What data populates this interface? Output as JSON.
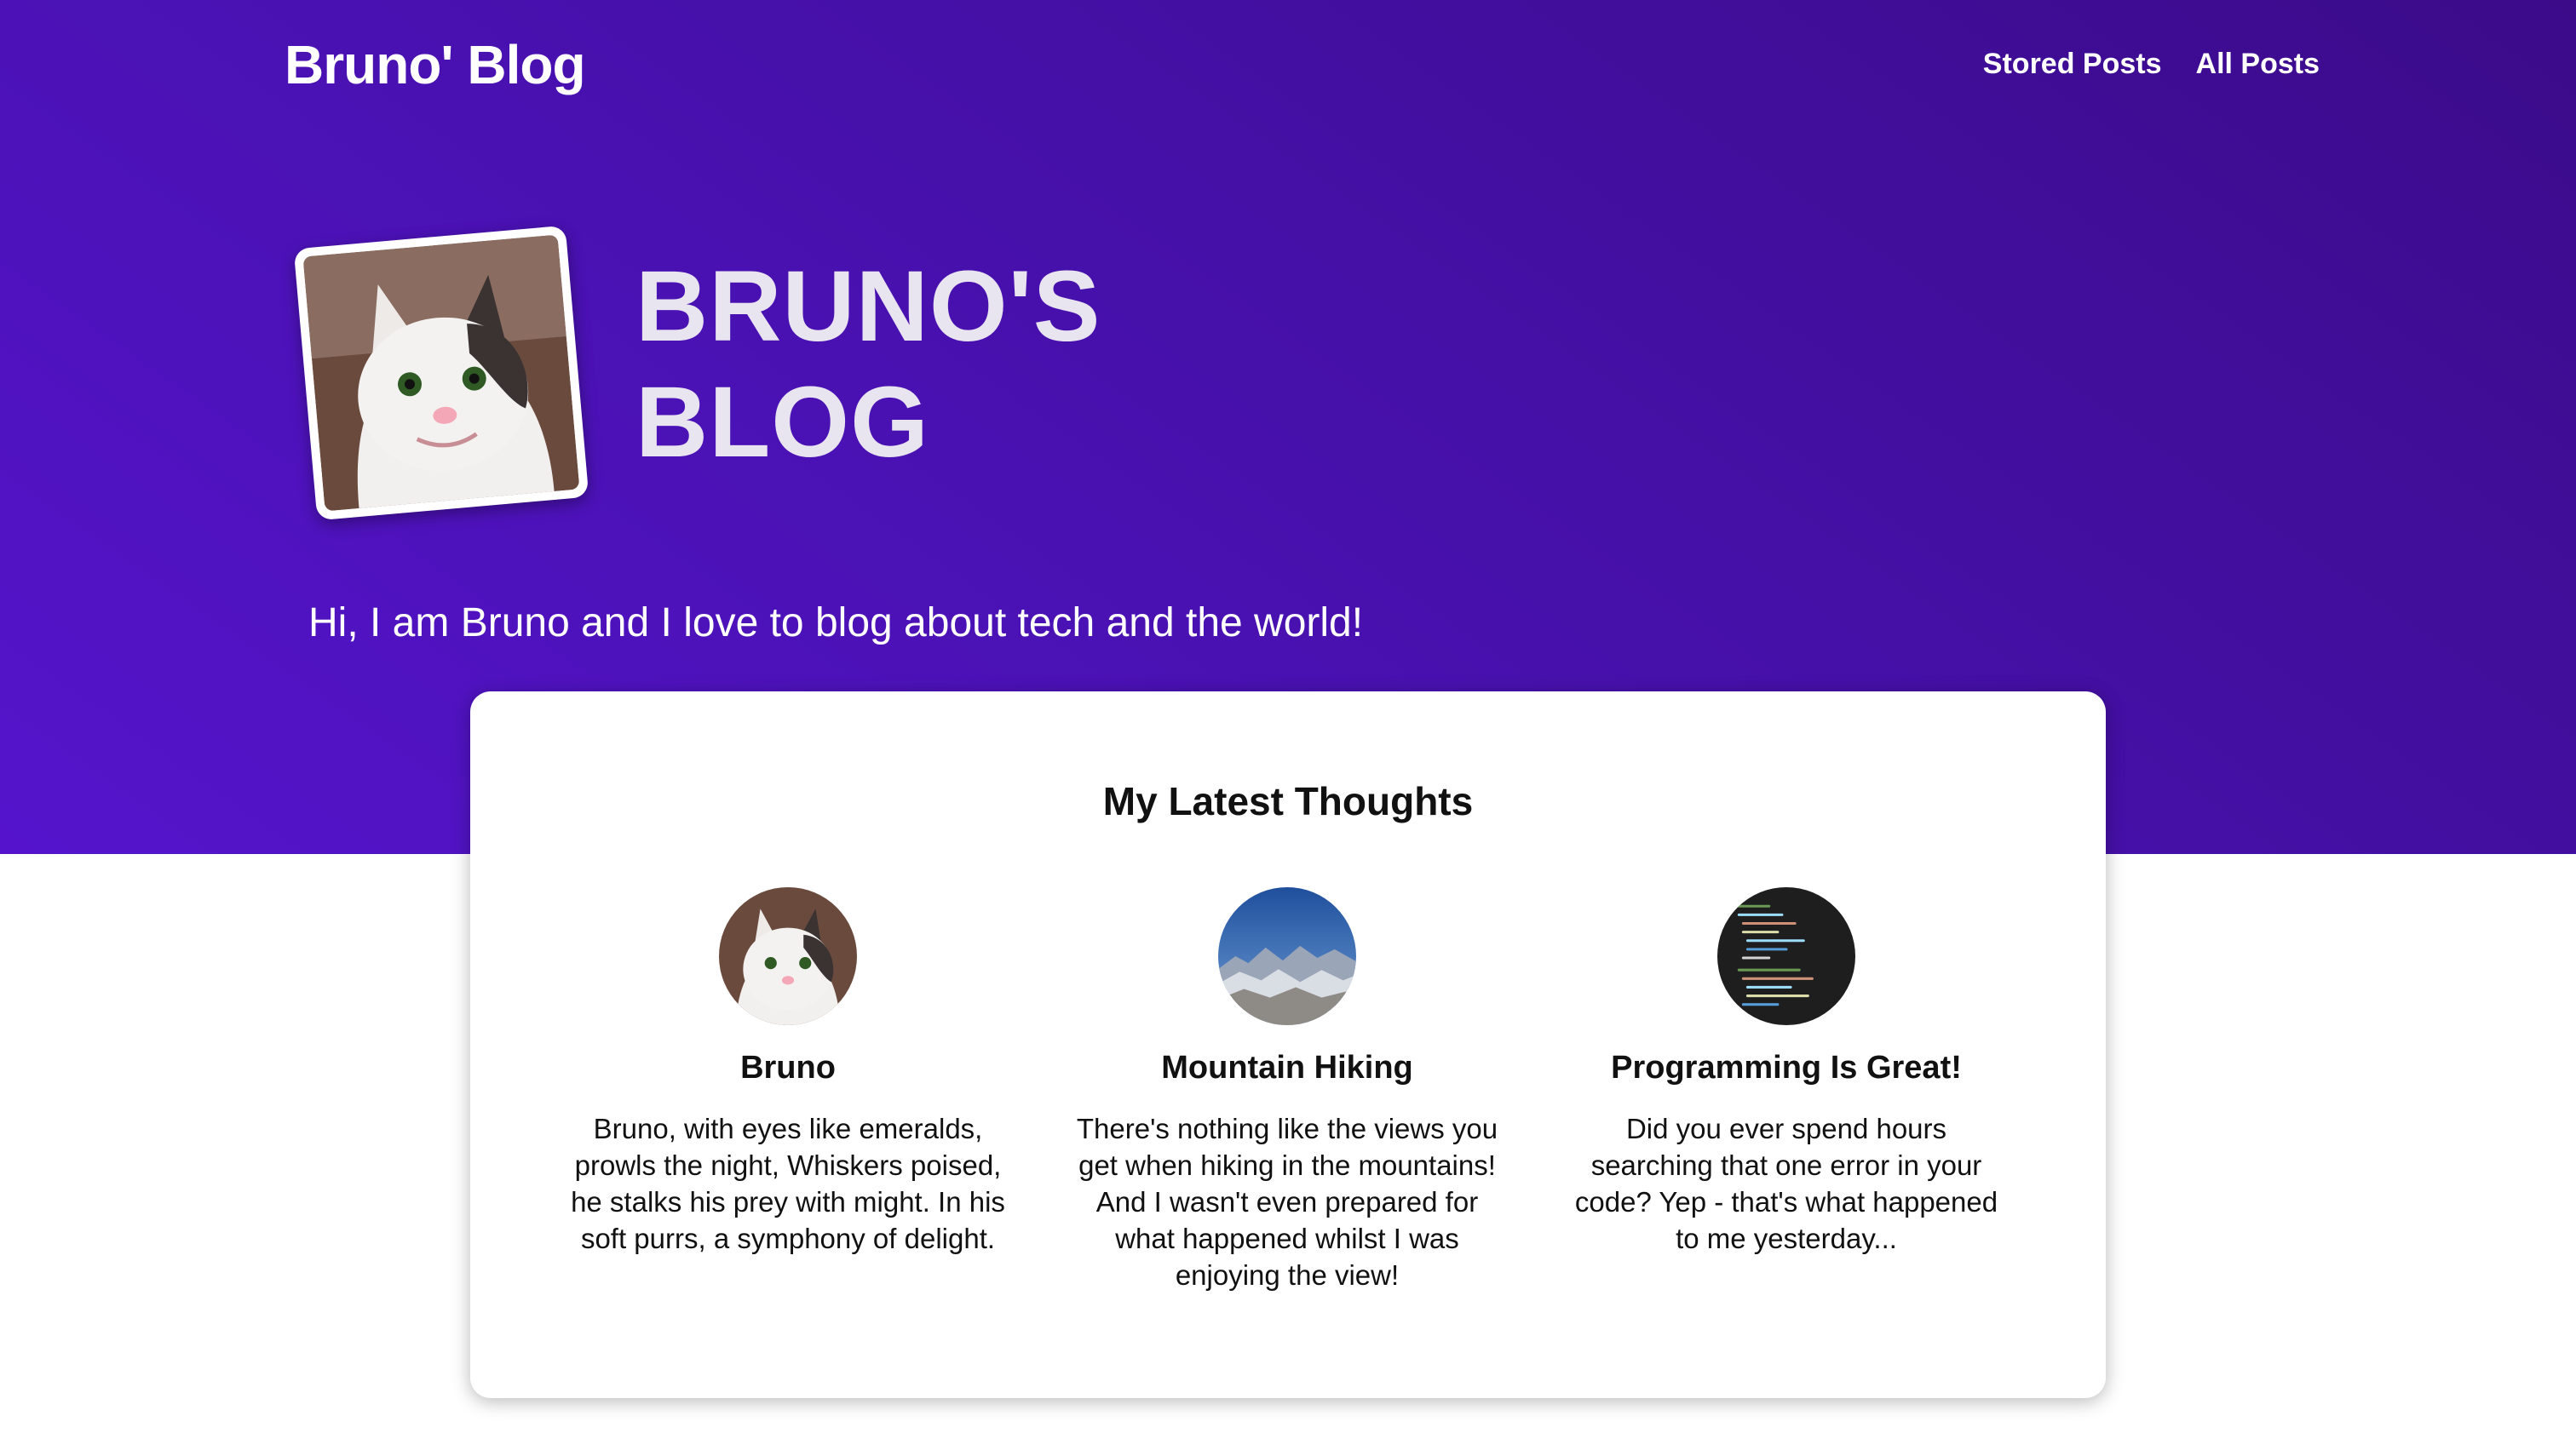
{
  "header": {
    "site_title": "Bruno' Blog",
    "nav": [
      {
        "label": "Stored Posts"
      },
      {
        "label": "All Posts"
      }
    ]
  },
  "hero": {
    "heading": "BRUNO'S BLOG",
    "tagline": "Hi, I am Bruno and I love to blog about tech and the world!"
  },
  "latest": {
    "title": "My Latest Thoughts",
    "posts": [
      {
        "title": "Bruno",
        "excerpt": "Bruno, with eyes like emeralds, prowls the night, Whiskers poised, he stalks his prey with might. In his soft purrs, a symphony of delight."
      },
      {
        "title": "Mountain Hiking",
        "excerpt": "There's nothing like the views you get when hiking in the mountains! And I wasn't even prepared for what happened whilst I was enjoying the view!"
      },
      {
        "title": "Programming Is Great!",
        "excerpt": "Did you ever spend hours searching that one error in your code? Yep - that's what happened to me yesterday..."
      }
    ]
  },
  "colors": {
    "hero_gradient_start": "#3b0b8a",
    "hero_gradient_end": "#5514cc",
    "text_dark": "#111111",
    "text_light": "#ffffff"
  }
}
